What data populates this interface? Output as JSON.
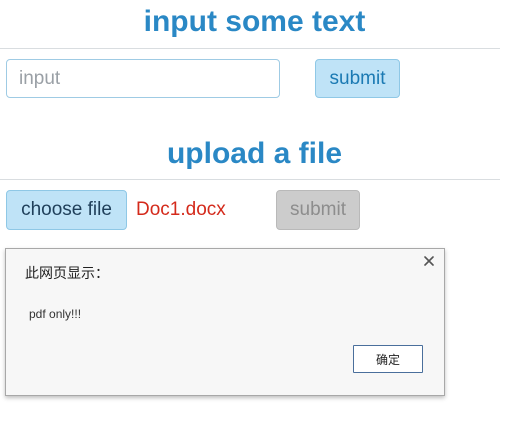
{
  "text_section": {
    "title": "input some text",
    "input_placeholder": "input",
    "input_value": "",
    "submit_label": "submit"
  },
  "upload_section": {
    "title": "upload a file",
    "choose_label": "choose file",
    "file_name": "Doc1.docx",
    "submit_label": "submit",
    "submit_disabled": true
  },
  "alert_dialog": {
    "title": "此网页显示：",
    "message": "pdf only!!!",
    "ok_label": "确定",
    "close_icon": "close-icon"
  },
  "colors": {
    "heading": "#2a88c5",
    "button_bg": "#bfe3f7",
    "file_name": "#d42a1b",
    "disabled_bg": "#cccccc"
  }
}
